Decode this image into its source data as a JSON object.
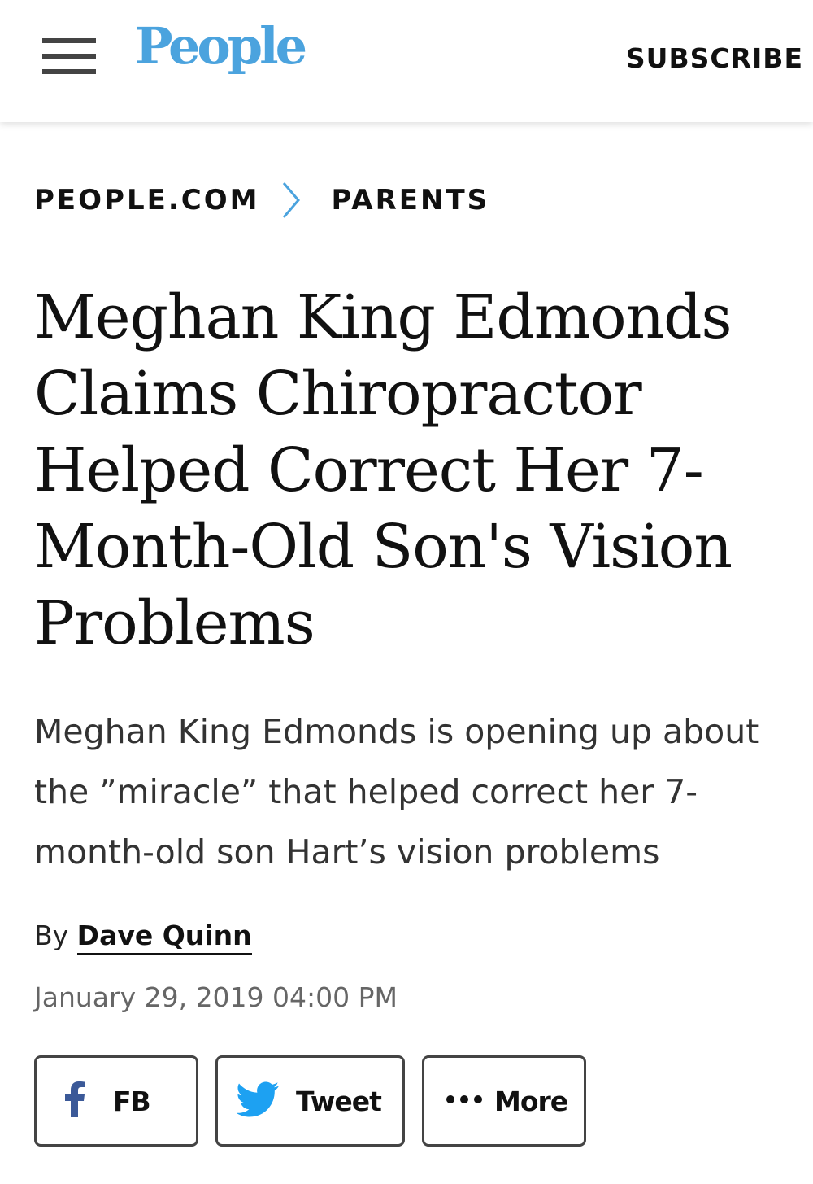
{
  "header": {
    "logo_text": "People",
    "subscribe_label": "SUBSCRIBE",
    "menu_icon": "hamburger-menu-icon"
  },
  "breadcrumb": {
    "items": [
      "PEOPLE.COM",
      "PARENTS"
    ],
    "separator_icon": "chevron-right-icon",
    "separator_color": "#4ba3de"
  },
  "article": {
    "headline": "Meghan King Edmonds Claims Chiropractor Helped Correct Her 7-Month-Old Son's Vision Problems",
    "dek": "Meghan King Edmonds is opening up about the ”miracle” that helped correct her 7-month-old son Hart’s vision problems",
    "byline_prefix": "By",
    "author": "Dave Quinn",
    "date": "January 29, 2019 04:00 PM"
  },
  "share": {
    "buttons": [
      {
        "label": "FB",
        "icon": "facebook-icon"
      },
      {
        "label": "Tweet",
        "icon": "twitter-bird-icon"
      },
      {
        "label": "More",
        "icon": "more-dots-icon"
      }
    ]
  },
  "colors": {
    "brand_blue": "#4ba3de",
    "facebook_blue": "#3b5998",
    "twitter_blue": "#1da1f2",
    "text": "#111111",
    "muted": "#666666"
  }
}
